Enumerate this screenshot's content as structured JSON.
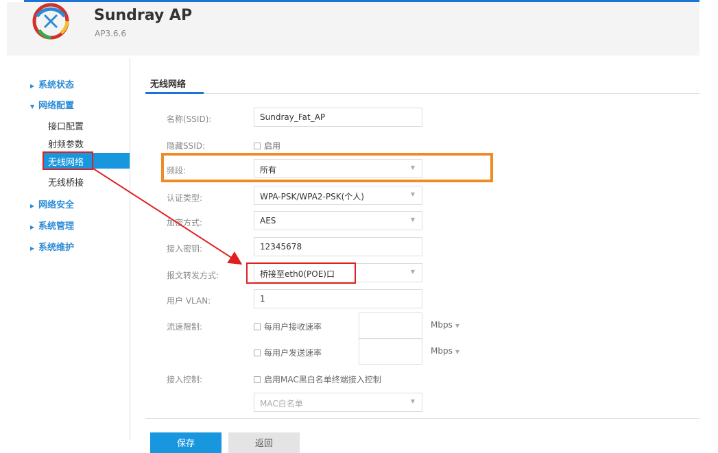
{
  "header": {
    "brand": "Sundray AP",
    "version": "AP3.6.6"
  },
  "sidebar": {
    "groups": [
      {
        "label": "系统状态"
      },
      {
        "label": "网络配置",
        "items": [
          "接口配置",
          "射频参数",
          "无线网络",
          "无线桥接"
        ]
      },
      {
        "label": "网络安全"
      },
      {
        "label": "系统管理"
      },
      {
        "label": "系统维护"
      }
    ],
    "active_item": "无线网络"
  },
  "main": {
    "tab_title": "无线网络",
    "form": {
      "ssid_label": "名称(SSID):",
      "ssid_value": "Sundray_Fat_AP",
      "hide_label": "隐藏SSID:",
      "hide_option": "启用",
      "band_label": "频段:",
      "band_value": "所有",
      "auth_label": "认证类型:",
      "auth_value": "WPA-PSK/WPA2-PSK(个人)",
      "enc_label": "加密方式:",
      "enc_value": "AES",
      "key_label": "接入密钥:",
      "key_value": "12345678",
      "fwd_label": "报文转发方式:",
      "fwd_value": "桥接至eth0(POE)口",
      "vlan_label": "用户 VLAN:",
      "vlan_value": "1",
      "rate_label": "流速限制:",
      "rate_rx": "每用户接收速率",
      "rate_tx": "每用户发送速率",
      "unit": "Mbps",
      "access_label": "接入控制:",
      "access_option": "启用MAC黑白名单终端接入控制",
      "mac_list": "MAC白名单"
    },
    "buttons": {
      "save": "保存",
      "back": "返回"
    }
  },
  "colors": {
    "accent": "#1897de",
    "highlight_orange": "#f08a24",
    "annotation_red": "#e02020"
  }
}
